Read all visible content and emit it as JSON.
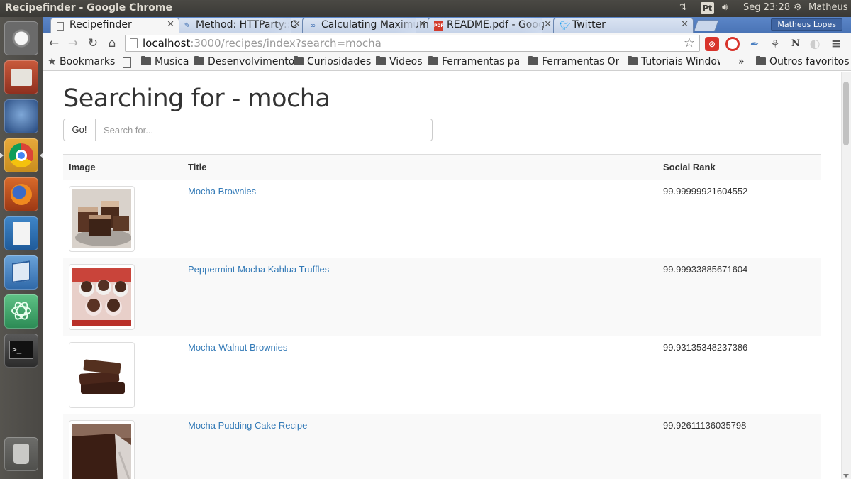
{
  "os_panel": {
    "window_title": "Recipefinder - Google Chrome",
    "keyboard_indicator": "Pt",
    "clock": "Seg 23:28",
    "user": "Matheus"
  },
  "launcher": {
    "items": [
      "dash-home",
      "files",
      "thunderbird",
      "chrome",
      "firefox",
      "writer",
      "virtualbox",
      "atom",
      "terminal",
      "trash"
    ]
  },
  "browser": {
    "tabs": [
      {
        "label": "Recipefinder",
        "icon": "page-icon",
        "active": true
      },
      {
        "label": "Method: HTTParty::C",
        "icon": "ruby-doc-icon",
        "active": false
      },
      {
        "label": "Calculating Maximum",
        "icon": "link-icon",
        "active": false
      },
      {
        "label": "README.pdf - Goog",
        "icon": "pdf-icon",
        "active": false
      },
      {
        "label": "Twitter",
        "icon": "twitter-icon",
        "active": false
      }
    ],
    "profile_name": "Matheus Lopes",
    "url_host": "localhost",
    "url_rest": ":3000/recipes/index?search=mocha",
    "bookmarks": {
      "label": "Bookmarks",
      "items": [
        "Musica",
        "Desenvolvimento",
        "Curiosidades",
        "Videos",
        "Ferramentas para",
        "Ferramentas Online",
        "Tutoriais Windows"
      ],
      "overflow": "»",
      "other": "Outros favoritos"
    }
  },
  "page": {
    "heading": "Searching for - mocha",
    "search": {
      "button_label": "Go!",
      "placeholder": "Search for..."
    },
    "table": {
      "headers": {
        "image": "Image",
        "title": "Title",
        "rank": "Social Rank"
      },
      "rows": [
        {
          "title": "Mocha Brownies",
          "rank": "99.99999921604552"
        },
        {
          "title": "Peppermint Mocha Kahlua Truffles",
          "rank": "99.99933885671604"
        },
        {
          "title": "Mocha-Walnut Brownies",
          "rank": "99.93135348237386"
        },
        {
          "title": "Mocha Pudding Cake Recipe",
          "rank": "99.92611136035798"
        }
      ]
    }
  },
  "colors": {
    "link": "#337ab7",
    "tabstrip": "#4a74b6"
  }
}
